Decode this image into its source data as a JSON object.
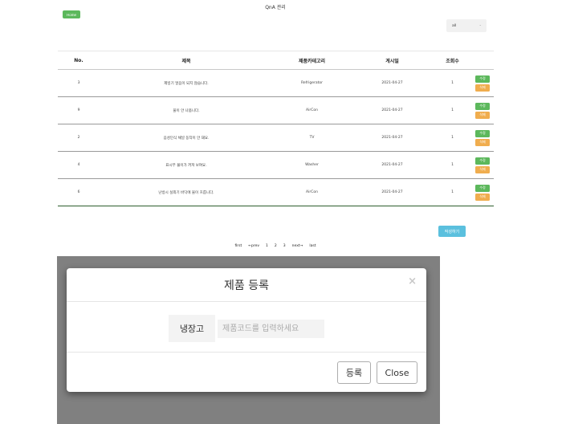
{
  "header": {
    "title": "QnA 관리",
    "home_label": "Home"
  },
  "filter": {
    "selected": "all"
  },
  "table": {
    "columns": [
      "No.",
      "제목",
      "제품카테고리",
      "게시일",
      "조회수"
    ],
    "edit_label": "수정",
    "delete_label": "삭제",
    "rows": [
      {
        "no": "3",
        "title": "제빙기 얼음이 되지 않습니다.",
        "category": "Refrigerator",
        "date": "2021-04-27",
        "views": "1"
      },
      {
        "no": "9",
        "title": "물이 안 나옵니다.",
        "category": "AirCon",
        "date": "2021-04-27",
        "views": "1"
      },
      {
        "no": "2",
        "title": "음성인식 채널 동작이 안 돼요.",
        "category": "TV",
        "date": "2021-04-27",
        "views": "1"
      },
      {
        "no": "4",
        "title": "표시부 불이가 꺼져 보여요.",
        "category": "Washer",
        "date": "2021-04-27",
        "views": "1"
      },
      {
        "no": "6",
        "title": "난방시 실외기 바닥에 물이 흐릅니다.",
        "category": "AirCon",
        "date": "2021-04-27",
        "views": "1"
      }
    ]
  },
  "write_button": "작성하기",
  "pagination": [
    "first",
    "←prev",
    "1",
    "2",
    "3",
    "next→",
    "last"
  ],
  "modal": {
    "title": "제품 등록",
    "close_glyph": "×",
    "field_label": "냉장고",
    "input_placeholder": "제품코드를 입력하세요",
    "input_value": "",
    "register_label": "등록",
    "close_label": "Close"
  }
}
